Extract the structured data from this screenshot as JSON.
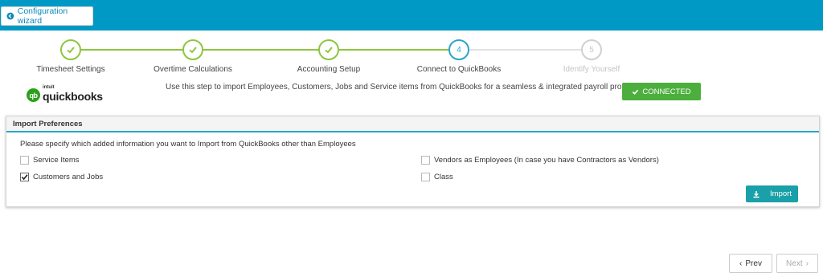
{
  "header": {
    "wizard_label": "Configuration wizard",
    "bar_color": "#0099c6"
  },
  "steps": [
    {
      "label": "Timesheet Settings",
      "state": "done",
      "number": ""
    },
    {
      "label": "Overtime Calculations",
      "state": "done",
      "number": ""
    },
    {
      "label": "Accounting Setup",
      "state": "done",
      "number": ""
    },
    {
      "label": "Connect to QuickBooks",
      "state": "active",
      "number": "4"
    },
    {
      "label": "Identify Yourself",
      "state": "todo",
      "number": "5"
    }
  ],
  "quickbooks": {
    "logo_intuit": "intuit",
    "logo_name": "quickbooks",
    "logo_mark": "qb",
    "description": "Use this step to import Employees, Customers, Jobs and Service items from QuickBooks for a seamless & integrated payroll processing",
    "status_label": "CONNECTED",
    "status_color": "#4caf3d"
  },
  "import_panel": {
    "title": "Import Preferences",
    "instruction": "Please specify which added information you want to Import from QuickBooks other than Employees",
    "options": [
      {
        "label": "Service Items",
        "checked": false
      },
      {
        "label": "Customers and Jobs",
        "checked": true
      },
      {
        "label": "Vendors as Employees (In case you have Contractors as Vendors)",
        "checked": false
      },
      {
        "label": "Class",
        "checked": false
      }
    ],
    "import_label": "Import",
    "accent_color": "#2aa6c8"
  },
  "navigation": {
    "prev_label": "Prev",
    "next_label": "Next"
  }
}
